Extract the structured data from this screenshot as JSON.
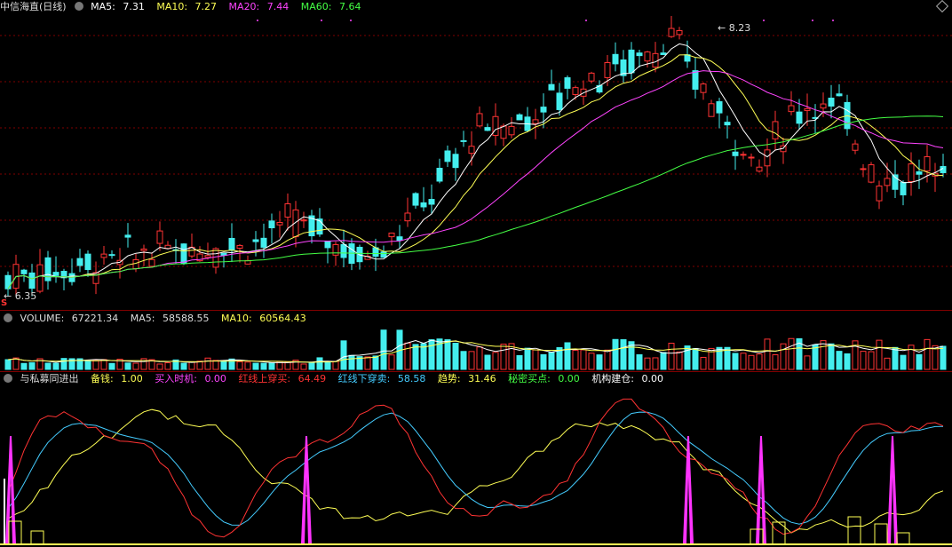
{
  "main_header": {
    "stock_name": "中信海直",
    "period": "(日线)",
    "ma_items": [
      {
        "label": "MA5:",
        "value": "7.31",
        "color": "#ffffff"
      },
      {
        "label": "MA10:",
        "value": "7.27",
        "color": "#ffff55"
      },
      {
        "label": "MA20:",
        "value": "7.44",
        "color": "#ff44ff"
      },
      {
        "label": "MA60:",
        "value": "7.64",
        "color": "#44ff44"
      }
    ]
  },
  "price_marks": {
    "high_label": "8.23",
    "low_label": "6.35"
  },
  "volume_header": {
    "items": [
      {
        "label": "VOLUME:",
        "value": "67221.34",
        "color": "#dddddd"
      },
      {
        "label": "MA5:",
        "value": "58588.55",
        "color": "#dddddd"
      },
      {
        "label": "MA10:",
        "value": "60564.43",
        "color": "#ffff55"
      }
    ]
  },
  "indicator_header": {
    "name": "与私募同进出",
    "items": [
      {
        "label": "备钱:",
        "value": "1.00",
        "color": "#ffff55"
      },
      {
        "label": "买入时机:",
        "value": "0.00",
        "color": "#ff44ff"
      },
      {
        "label": "红线上穿买:",
        "value": "64.49",
        "color": "#ff3333"
      },
      {
        "label": "红线下穿卖:",
        "value": "58.58",
        "color": "#44ccff"
      },
      {
        "label": "趋势:",
        "value": "31.46",
        "color": "#ffff55"
      },
      {
        "label": "秘密买点:",
        "value": "0.00",
        "color": "#44ff44"
      },
      {
        "label": "机构建仓:",
        "value": "0.00",
        "color": "#ffffff"
      }
    ]
  },
  "colors": {
    "up": "#ff3333",
    "down": "#44eeee",
    "ma5": "#ffffff",
    "ma10": "#ffff55",
    "ma20": "#ff44ff",
    "ma60": "#44ff44",
    "grid": "#800000"
  }
}
